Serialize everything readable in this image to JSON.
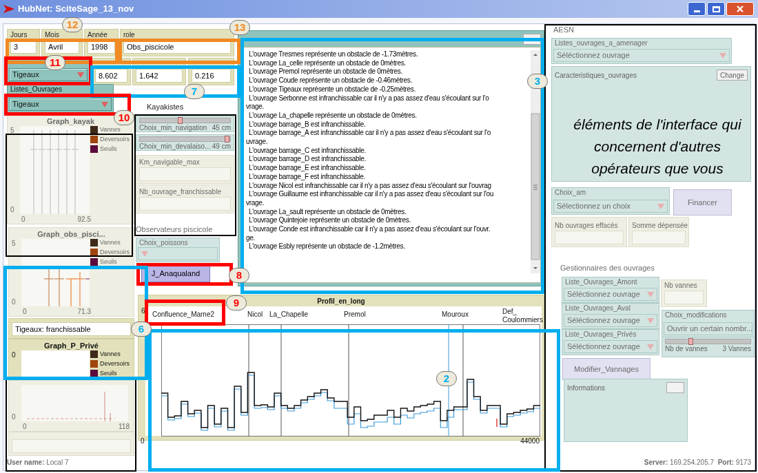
{
  "window": {
    "title": "HubNet: SciteSage_13_nov"
  },
  "widgets": [
    {
      "kind": "monitor",
      "dimmed": false,
      "label": "Jours",
      "value": "3"
    },
    {
      "kind": "monitor",
      "dimmed": false,
      "label": "Mois",
      "value": "Avril"
    },
    {
      "kind": "monitor",
      "dimmed": false,
      "label": "Année",
      "value": "1998"
    },
    {
      "kind": "monitor",
      "dimmed": false,
      "label": "role",
      "value": "Obs_piscicole"
    },
    {
      "kind": "chooser",
      "dimmed": false,
      "value": "Tigeaux"
    },
    {
      "kind": "monitor",
      "dimmed": false,
      "value": "8.602"
    },
    {
      "kind": "monitor",
      "dimmed": false,
      "value": "1.642"
    },
    {
      "kind": "monitor",
      "dimmed": false,
      "value": "0.216"
    },
    {
      "kind": "chooser",
      "dimmed": false,
      "label": "Listes_Ouvrages",
      "value": "Tigeaux"
    },
    {
      "kind": "label",
      "dimmed": false,
      "text": "Kayakistes"
    },
    {
      "kind": "plot",
      "dimmed": true,
      "title": "Graph_kayak",
      "y_max": "5",
      "y_min": "0",
      "x_min": "0",
      "x_max": "92.5",
      "legend": [
        {
          "label": "Vannes",
          "color": "#3f2a1a"
        },
        {
          "label": "Deversoirs",
          "color": "#a0440f"
        },
        {
          "label": "Seuils",
          "color": "#5c0a3c"
        }
      ]
    },
    {
      "kind": "slider",
      "dimmed": true,
      "label": "Choix_min_navigation",
      "reading": "45 cm",
      "level": 0.45
    },
    {
      "kind": "slider",
      "dimmed": true,
      "label": "Choix_min_devalaiso...",
      "reading": "49 cm",
      "level": 0.97
    },
    {
      "kind": "monitor",
      "dimmed": true,
      "label": "Km_navigable_max"
    },
    {
      "kind": "monitor",
      "dimmed": true,
      "label": "Nb_ouvrage_franchissable"
    },
    {
      "kind": "label",
      "dimmed": true,
      "text": "Observateurs piscicole"
    },
    {
      "kind": "chooser",
      "dimmed": true,
      "label": "Choix_poissons"
    },
    {
      "kind": "button",
      "dimmed": false,
      "label": "J_Anaqualand"
    },
    {
      "kind": "output",
      "dimmed": false,
      "lines": [
        {
          "kind": "line",
          "text": "L'ouvrage Tresmes représente un obstacle de -1.73mètres."
        },
        {
          "kind": "line",
          "text": "L'ouvrage La_celle représente un obstacle de 0mètres."
        },
        {
          "kind": "line",
          "text": "L'ouvrage Premol représente un obstacle de 0mètres."
        },
        {
          "kind": "line",
          "text": "L'ouvrage Coude représente un obstacle de -0.46mètres."
        },
        {
          "kind": "line",
          "text": "L'ouvrage Tigeaux représente un obstacle de -0.25mètres."
        },
        {
          "kind": "line",
          "text": "L'ouvrage Serbonne est infranchissable car il n'y a pas assez d'eau s'écoulant sur l'o"
        },
        {
          "kind": "wrap",
          "text": "vrage."
        },
        {
          "kind": "line",
          "text": "L'ouvrage La_chapelle représente un obstacle de 0mètres."
        },
        {
          "kind": "line",
          "text": "L'ouvrage barrage_B est infranchissable."
        },
        {
          "kind": "line",
          "text": "L'ouvrage barrage_A est infranchissable car il n'y a pas assez d'eau s'écoulant sur l'o"
        },
        {
          "kind": "wrap",
          "text": "uvrage."
        },
        {
          "kind": "line",
          "text": "L'ouvrage barrage_C est infranchissable."
        },
        {
          "kind": "line",
          "text": "L'ouvrage barrage_D est infranchissable."
        },
        {
          "kind": "line",
          "text": "L'ouvrage barrage_E est infranchissable."
        },
        {
          "kind": "line",
          "text": "L'ouvrage barrage_F est infranchissable."
        },
        {
          "kind": "line",
          "text": "L'ouvrage Nicol est infranchissable car il n'y a pas assez d'eau s'écoulant sur l'ouvrag"
        },
        {
          "kind": "line",
          "text": "L'ouvrage Guillaume est infranchissable car il n'y a pas assez d'eau s'écoulant sur l'ou"
        },
        {
          "kind": "wrap",
          "text": "vrage."
        },
        {
          "kind": "line",
          "text": "L'ouvrage La_sault représente un obstacle de 0mètres."
        },
        {
          "kind": "line",
          "text": "L'ouvrage Quintejoie représente un obstacle de 0mètres."
        },
        {
          "kind": "line",
          "text": "L'ouvrage Conde est infranchissable car il n'y a pas assez d'eau s'écoulant sur l'ouvr."
        },
        {
          "kind": "wrap",
          "text": "ge."
        },
        {
          "kind": "line",
          "text": "L'ouvrage Esbly représente un obstacle de -1.2mètres."
        }
      ]
    },
    {
      "kind": "plot",
      "dimmed": true,
      "title": "Graph_obs_pisci...",
      "y_max": "5",
      "y_min": "0",
      "x_min": "0",
      "x_max": "71.3",
      "legend": [
        {
          "label": "Vannes",
          "color": "#3f2a1a"
        },
        {
          "label": "Deversoirs",
          "color": "#a0440f"
        },
        {
          "label": "Seuils",
          "color": "#5c0a3c"
        }
      ]
    },
    {
      "kind": "monitor",
      "dimmed": false,
      "value": "Tigeaux: franchissable"
    },
    {
      "kind": "plot",
      "dimmed": false,
      "title": "Graph_P_Privé",
      "y_max": "0",
      "legend": [
        {
          "label": "Vannes",
          "color": "#3f2a1a"
        },
        {
          "label": "Deversoirs",
          "color": "#a0440f"
        },
        {
          "label": "Seuils",
          "color": "#5c0a3c"
        }
      ]
    },
    {
      "kind": "plot",
      "dimmed": true,
      "y_min": "0",
      "x_min": "0",
      "x_max": "118"
    },
    {
      "kind": "monitor",
      "dimmed": true
    },
    {
      "kind": "profile",
      "dimmed": false,
      "title": "Profil_en_long",
      "y_max": "6",
      "x_min": "0",
      "x_max": "44000",
      "labels": [
        "Confluence_Marne2",
        "Nicol",
        "La_Chapelle",
        "Premol",
        "Mouroux",
        "Def_ Coulommiers"
      ]
    },
    {
      "kind": "label",
      "dimmed": true,
      "text": "AESN"
    },
    {
      "kind": "chooser",
      "dimmed": true,
      "label": "Listes_ouvrages_a_amenager",
      "value": "Séléctionnez ouvrage"
    },
    {
      "kind": "output",
      "dimmed": true,
      "title": "Caracteristiques_ouvrages",
      "button": "Change"
    },
    {
      "kind": "chooser",
      "dimmed": true,
      "label": "Choix_am",
      "value": "Sélectionnez un choix"
    },
    {
      "kind": "button",
      "dimmed": true,
      "label": "Financer"
    },
    {
      "kind": "monitor",
      "dimmed": true,
      "label": "Nb ouvrages effacés"
    },
    {
      "kind": "monitor",
      "dimmed": true,
      "label": "Somme dépensée"
    },
    {
      "kind": "label",
      "dimmed": true,
      "text": "Gestionnaires des ouvrages"
    },
    {
      "kind": "chooser",
      "dimmed": true,
      "label": "Liste_Ouvrages_Amont",
      "value": "Séléctionnez ouvrage"
    },
    {
      "kind": "monitor",
      "dimmed": true,
      "label": "Nb vannes"
    },
    {
      "kind": "chooser",
      "dimmed": true,
      "label": "Liste_Ouvrages_Aval",
      "value": "Séléctionnez ouvrage"
    },
    {
      "kind": "chooser",
      "dimmed": true,
      "label": "Choix_modifications",
      "value": "Ouvrir un certain nombr..."
    },
    {
      "kind": "chooser",
      "dimmed": true,
      "label": "Liste_Ouvrages_Privés",
      "value": "Séléctionnez ouvrage"
    },
    {
      "kind": "slider",
      "dimmed": true,
      "label": "Nb de vannes",
      "reading": "3 Vannes",
      "level": 0.3
    },
    {
      "kind": "button",
      "dimmed": true,
      "label": "Modifier_Vannages"
    },
    {
      "kind": "output",
      "dimmed": true,
      "title": "Informations"
    }
  ],
  "status_bar": {
    "user": "**User name:** Local 7",
    "server": "**Server:** 169.254.205.7  **Port:** 9173"
  },
  "caption": "éléments de l'interface qui concernent d'autres opérateurs que vous",
  "annotations": [
    {
      "number": "12",
      "color": "#f08a24"
    },
    {
      "number": "13",
      "color": "#f08a24"
    },
    {
      "number": "11",
      "color": "#ff0000"
    },
    {
      "number": "7",
      "color": "#00aeef"
    },
    {
      "number": "3",
      "color": "#00aeef"
    },
    {
      "number": "10",
      "color": "#ff0000"
    },
    {
      "number": "8",
      "color": "#ff0000"
    },
    {
      "number": "6",
      "color": "#00aeef"
    },
    {
      "number": "9",
      "color": "#ff0000"
    },
    {
      "number": "2",
      "color": "#00aeef"
    }
  ]
}
